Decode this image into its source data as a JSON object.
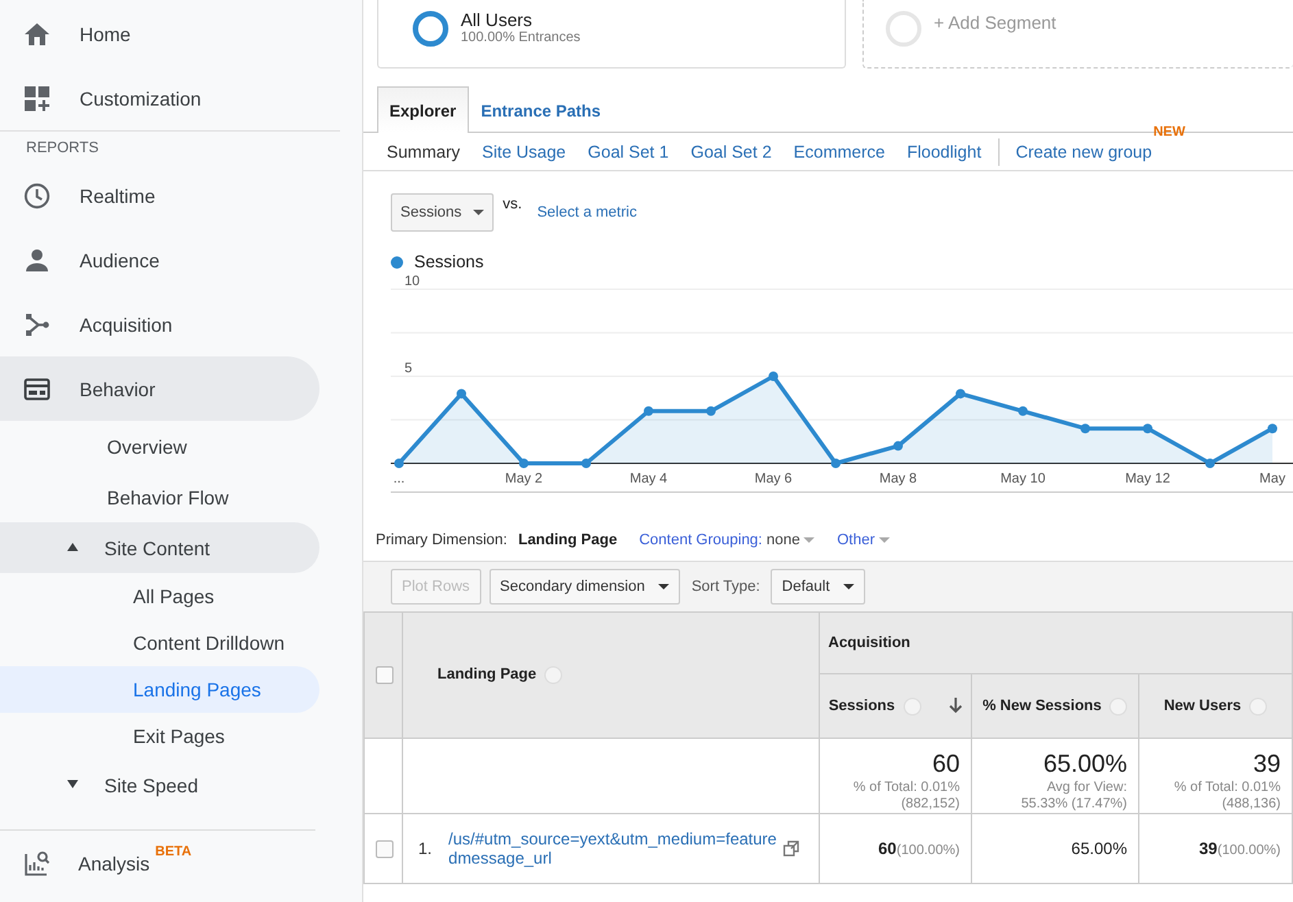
{
  "sidebar": {
    "top_items": [
      {
        "label": "Home",
        "selected": false
      },
      {
        "label": "Customization",
        "selected": false
      }
    ],
    "section_label": "REPORTS",
    "items": [
      {
        "label": "Realtime",
        "selected": false
      },
      {
        "label": "Audience",
        "selected": false
      },
      {
        "label": "Acquisition",
        "selected": false
      },
      {
        "label": "Behavior",
        "selected": false,
        "expanded": true,
        "children": [
          {
            "label": "Overview",
            "selected": false
          },
          {
            "label": "Behavior Flow",
            "selected": false
          },
          {
            "label": "Site Content",
            "selected": false,
            "expanded": true,
            "children": [
              {
                "label": "All Pages",
                "selected": false
              },
              {
                "label": "Content Drilldown",
                "selected": false
              },
              {
                "label": "Landing Pages",
                "selected": true
              },
              {
                "label": "Exit Pages",
                "selected": false
              }
            ]
          },
          {
            "label": "Site Speed",
            "selected": false,
            "expanded": false
          }
        ]
      }
    ],
    "footer_item": {
      "label": "Analysis",
      "badge": "BETA",
      "selected": false
    }
  },
  "segments": [
    {
      "kind": "segment",
      "title": "All Users",
      "subtitle": "100.00% Entrances"
    },
    {
      "kind": "add",
      "title": "+ Add Segment"
    }
  ],
  "tabs": [
    {
      "label": "Explorer",
      "selected": true
    },
    {
      "label": "Entrance Paths",
      "selected": false
    }
  ],
  "subtabs": {
    "items": [
      {
        "label": "Summary",
        "selected": true
      },
      {
        "label": "Site Usage",
        "selected": false
      },
      {
        "label": "Goal Set 1",
        "selected": false
      },
      {
        "label": "Goal Set 2",
        "selected": false
      },
      {
        "label": "Ecommerce",
        "selected": false
      },
      {
        "label": "Floodlight",
        "selected": false
      }
    ],
    "create_link": {
      "label": "Create new group",
      "badge": "NEW"
    }
  },
  "metric": {
    "dropdown": "Sessions",
    "vs": "vs.",
    "link": "Select a metric"
  },
  "chart": {
    "chart_data": {
      "type": "area",
      "categories": [
        "...",
        null,
        "May 2",
        null,
        "May 4",
        null,
        "May 6",
        null,
        "May 8",
        null,
        "May 10",
        null,
        "May 12",
        null,
        "May"
      ],
      "series": [
        {
          "name": "Sessions",
          "color": "#2d8acf",
          "values": [
            0,
            4,
            0,
            0,
            3,
            3,
            5,
            0,
            1,
            4,
            3,
            2,
            2,
            0,
            2
          ]
        }
      ],
      "ylim": [
        0,
        10
      ],
      "yticks": [
        5,
        10
      ]
    }
  },
  "dimensions": {
    "label": "Primary Dimension:",
    "options": [
      {
        "kind": "plain",
        "label": "Landing Page",
        "selected": true
      },
      {
        "kind": "menu",
        "label": "Content Grouping:",
        "value": "none",
        "selected": false
      },
      {
        "kind": "menu",
        "label": "Other",
        "selected": false
      }
    ]
  },
  "toolbar": {
    "plot_rows": {
      "label": "Plot Rows",
      "disabled": true
    },
    "secondary": "Secondary dimension",
    "sort_label": "Sort Type:",
    "sort_value": "Default"
  },
  "table": {
    "all_checked": false,
    "group": "Acquisition",
    "dimension": "Landing Page",
    "columns": [
      {
        "label": "Sessions",
        "sorted": true
      },
      {
        "label": "% New Sessions",
        "sorted": false
      },
      {
        "label": "New Users",
        "sorted": false
      }
    ],
    "totals": [
      {
        "value": "60",
        "notes": [
          "% of Total: 0.01%",
          "(882,152)"
        ]
      },
      {
        "value": "65.00%",
        "notes": [
          "Avg for View:",
          "55.33% (17.47%)"
        ]
      },
      {
        "value": "39",
        "notes": [
          "% of Total: 0.01%",
          "(488,136)"
        ]
      }
    ],
    "rows": [
      {
        "checked": false,
        "index": "1.",
        "page": "/us/#utm_source=yext&utm_medium=featuredmessage_url",
        "cells": [
          {
            "value": "60",
            "share": "(100.00%)"
          },
          {
            "value": "65.00%"
          },
          {
            "value": "39",
            "share": "(100.00%)"
          }
        ]
      }
    ]
  }
}
